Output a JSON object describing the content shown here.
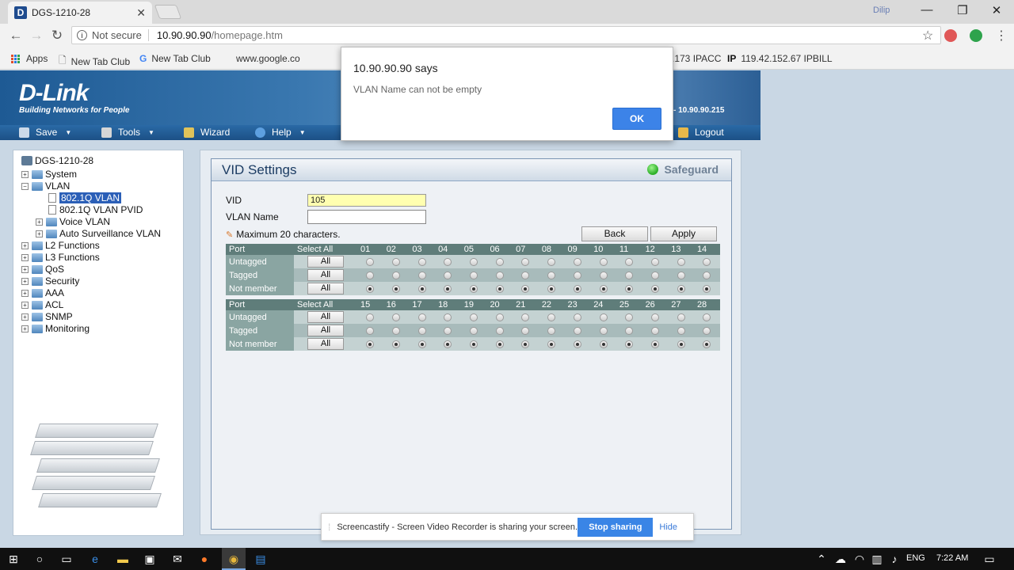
{
  "browser": {
    "tab_title": "DGS-1210-28",
    "tab_favicon": "D",
    "user_name": "Dilip",
    "not_secure": "Not secure",
    "url_host": "10.90.90.90",
    "url_path": "/homepage.htm",
    "bookmarks": [
      {
        "label": "Apps"
      },
      {
        "label": "New Tab Club"
      },
      {
        "label": "New Tab Club"
      },
      {
        "label": "www.google.co"
      },
      {
        "label": ".173 IPACC"
      },
      {
        "label": "119.42.152.67 IPBILL"
      }
    ]
  },
  "header": {
    "logo": "D-Link",
    "tagline": "Building Networks for People",
    "ip": "- 10.90.90.215"
  },
  "menu": {
    "save": "Save",
    "tools": "Tools",
    "wizard": "Wizard",
    "help": "Help",
    "logout": "Logout"
  },
  "tree": {
    "root": "DGS-1210-28",
    "items": [
      {
        "label": "System"
      },
      {
        "label": "VLAN"
      },
      {
        "label": "802.1Q VLAN"
      },
      {
        "label": "802.1Q VLAN PVID"
      },
      {
        "label": "Voice VLAN"
      },
      {
        "label": "Auto Surveillance VLAN"
      },
      {
        "label": "L2 Functions"
      },
      {
        "label": "L3 Functions"
      },
      {
        "label": "QoS"
      },
      {
        "label": "Security"
      },
      {
        "label": "AAA"
      },
      {
        "label": "ACL"
      },
      {
        "label": "SNMP"
      },
      {
        "label": "Monitoring"
      }
    ]
  },
  "vid_settings": {
    "title": "VID Settings",
    "safeguard": "Safeguard",
    "vid_label": "VID",
    "vid_value": "105",
    "vlan_name_label": "VLAN Name",
    "vlan_name_value": "",
    "hint": "Maximum 20 characters.",
    "back": "Back",
    "apply": "Apply",
    "col_port": "Port",
    "col_select_all": "Select All",
    "row_untagged": "Untagged",
    "row_tagged": "Tagged",
    "row_not_member": "Not member",
    "all_label": "All",
    "ports_a": [
      "01",
      "02",
      "03",
      "04",
      "05",
      "06",
      "07",
      "08",
      "09",
      "10",
      "11",
      "12",
      "13",
      "14"
    ],
    "ports_b": [
      "15",
      "16",
      "17",
      "18",
      "19",
      "20",
      "21",
      "22",
      "23",
      "24",
      "25",
      "26",
      "27",
      "28"
    ]
  },
  "dialog": {
    "title": "10.90.90.90 says",
    "message": "VLAN Name can not be empty",
    "ok": "OK"
  },
  "screencastify": {
    "message": "Screencastify - Screen Video Recorder is sharing your screen.",
    "stop": "Stop sharing",
    "hide": "Hide"
  },
  "taskbar": {
    "language": "ENG",
    "time": "7:22 AM"
  }
}
